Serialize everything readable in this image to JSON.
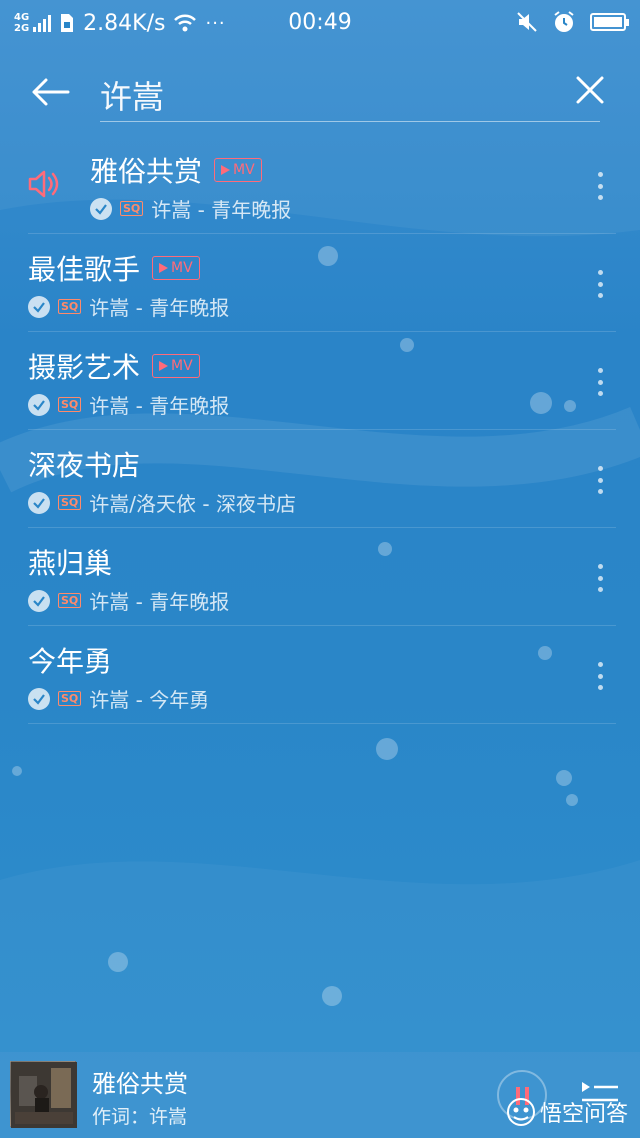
{
  "status_bar": {
    "network_top": "4G",
    "network_bottom": "2G",
    "speed": "2.84K/s",
    "time": "00:49"
  },
  "search": {
    "query": "许嵩"
  },
  "songs": [
    {
      "title": "雅俗共赏",
      "has_mv": true,
      "playing": true,
      "artist_album": "许嵩 - 青年晚报"
    },
    {
      "title": "最佳歌手",
      "has_mv": true,
      "playing": false,
      "artist_album": "许嵩 - 青年晚报"
    },
    {
      "title": "摄影艺术",
      "has_mv": true,
      "playing": false,
      "artist_album": "许嵩 - 青年晚报"
    },
    {
      "title": "深夜书店",
      "has_mv": false,
      "playing": false,
      "artist_album": "许嵩/洛天依 - 深夜书店"
    },
    {
      "title": "燕归巢",
      "has_mv": false,
      "playing": false,
      "artist_album": "许嵩 - 青年晚报"
    },
    {
      "title": "今年勇",
      "has_mv": false,
      "playing": false,
      "artist_album": "许嵩 - 今年勇"
    }
  ],
  "badges": {
    "mv": "MV",
    "quality": "SQ"
  },
  "player": {
    "title": "雅俗共赏",
    "subtitle": "作词：许嵩"
  },
  "watermark": {
    "text": "悟空问答"
  },
  "colors": {
    "accent_red": "#ff6b7a",
    "quality_orange": "#ff8a6a",
    "background_blue": "#2a86c8"
  }
}
